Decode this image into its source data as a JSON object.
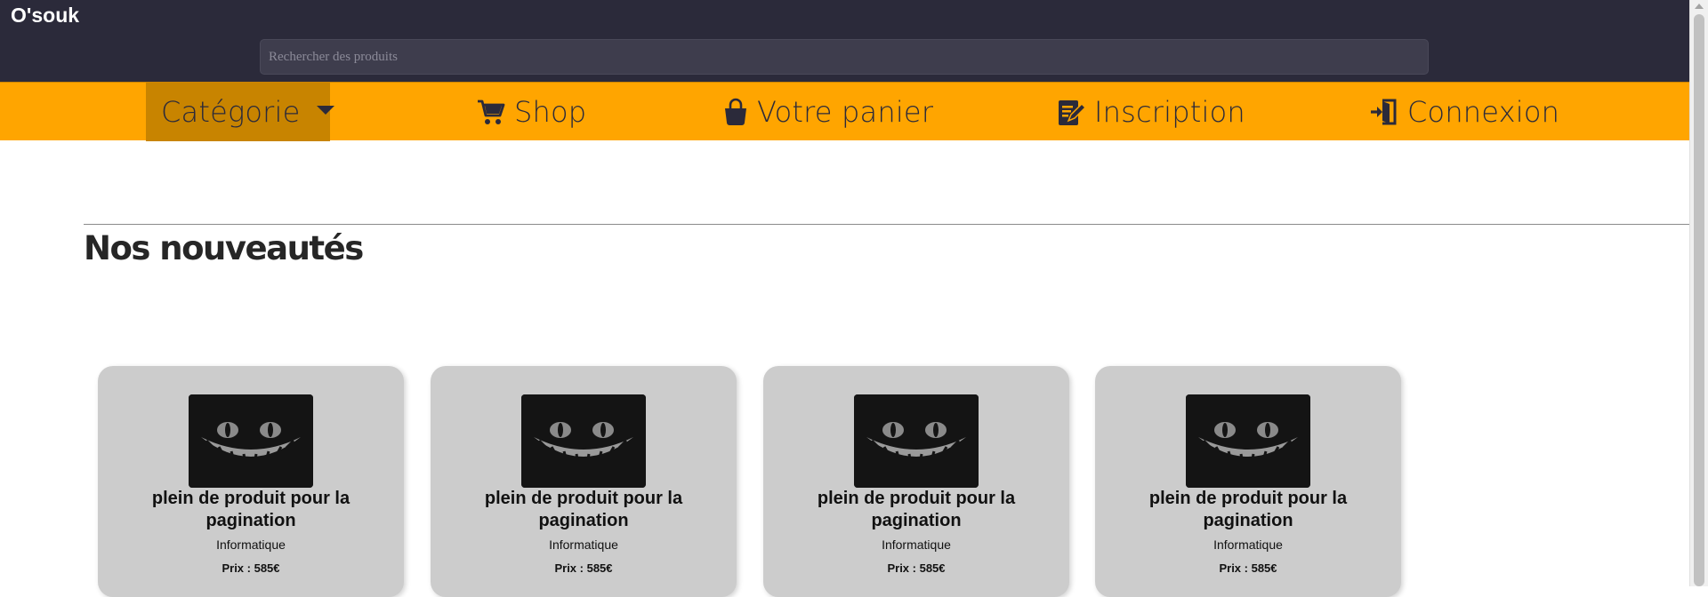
{
  "header": {
    "brand": "O'souk",
    "search_placeholder": "Rechercher des produits"
  },
  "nav": {
    "category_label": "Catégorie",
    "shop_label": "Shop",
    "cart_label": "Votre panier",
    "signup_label": "Inscription",
    "login_label": "Connexion"
  },
  "section": {
    "title": "Nos nouveautés"
  },
  "products": [
    {
      "name": "plein de produit pour la pagination",
      "category": "Informatique",
      "price": "Prix : 585€"
    },
    {
      "name": "plein de produit pour la pagination",
      "category": "Informatique",
      "price": "Prix : 585€"
    },
    {
      "name": "plein de produit pour la pagination",
      "category": "Informatique",
      "price": "Prix : 585€"
    },
    {
      "name": "plein de produit pour la pagination",
      "category": "Informatique",
      "price": "Prix : 585€"
    }
  ],
  "colors": {
    "topbar": "#2b2a3a",
    "navbar": "#ffa500",
    "nav_active": "#c88400",
    "card_bg": "#cccccc"
  }
}
